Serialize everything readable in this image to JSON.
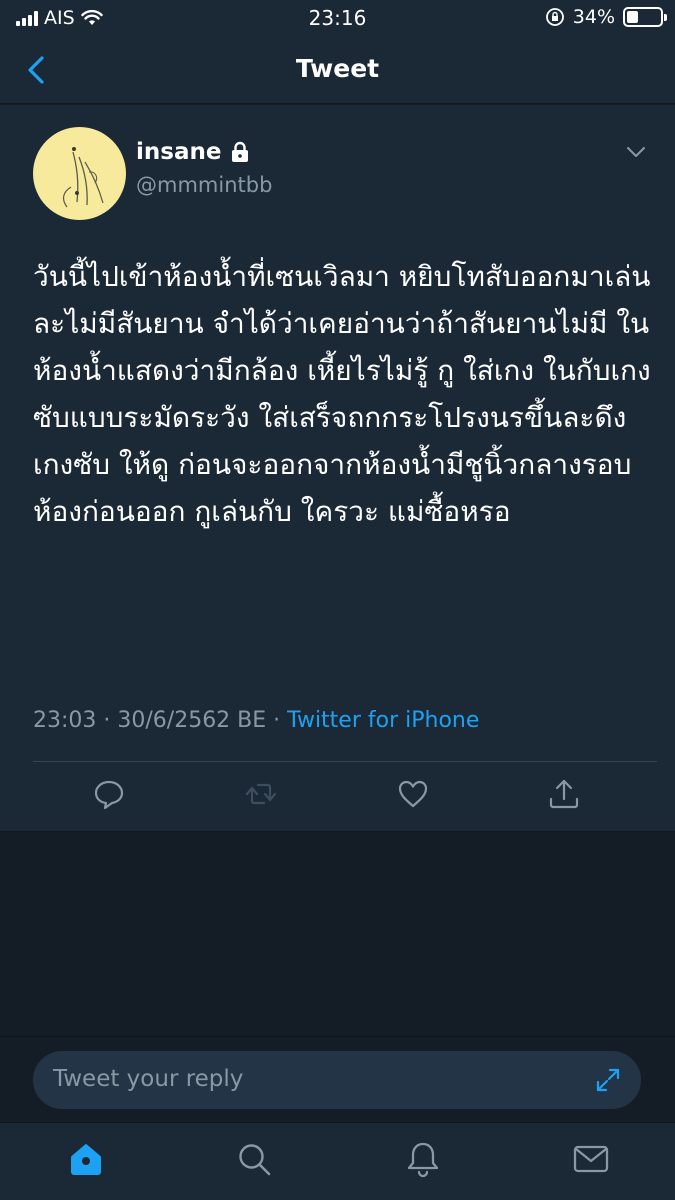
{
  "status_bar": {
    "carrier": "AIS",
    "time": "23:16",
    "battery_percent": "34%",
    "battery_level": 0.34
  },
  "nav": {
    "title": "Tweet"
  },
  "tweet": {
    "display_name": "insane",
    "handle": "@mmmintbb",
    "text": "วันนี้ไปเข้าห้องน้ำที่เซนเวิลมา หยิบโทสับออกมาเล่นละไม่มีสันยาน จำได้ว่าเคยอ่านว่าถ้าสันยานไม่มี ในห้องน้ำแสดงว่ามีกล้อง เหี้ยไรไม่รู้ กู ใส่เกง ในกับเกงซับแบบระมัดระวัง ใส่เสร็จถกกระโปรงนรขึ้นละดึงเกงซับ ให้ดู ก่อนจะออกจากห้องน้ำมีชูนิ้วกลางรอบห้องก่อนออก กูเล่นกับ ใครวะ แม่ซื้อหรอ",
    "timestamp": "23:03 · 30/6/2562 BE · ",
    "source": "Twitter for iPhone"
  },
  "reply": {
    "placeholder": "Tweet your reply"
  },
  "colors": {
    "background": "#141d26",
    "surface": "#1b2836",
    "accent": "#1da1f2",
    "secondary_text": "#8899a6",
    "input_bg": "#243447"
  },
  "icons": {
    "lock": "lock-icon",
    "back": "chevron-left-icon",
    "more": "chevron-down-icon",
    "reply": "reply-icon",
    "retweet": "retweet-icon",
    "like": "heart-icon",
    "share": "share-icon",
    "expand": "expand-icon",
    "home": "home-icon",
    "search": "search-icon",
    "notifications": "bell-icon",
    "messages": "mail-icon"
  }
}
